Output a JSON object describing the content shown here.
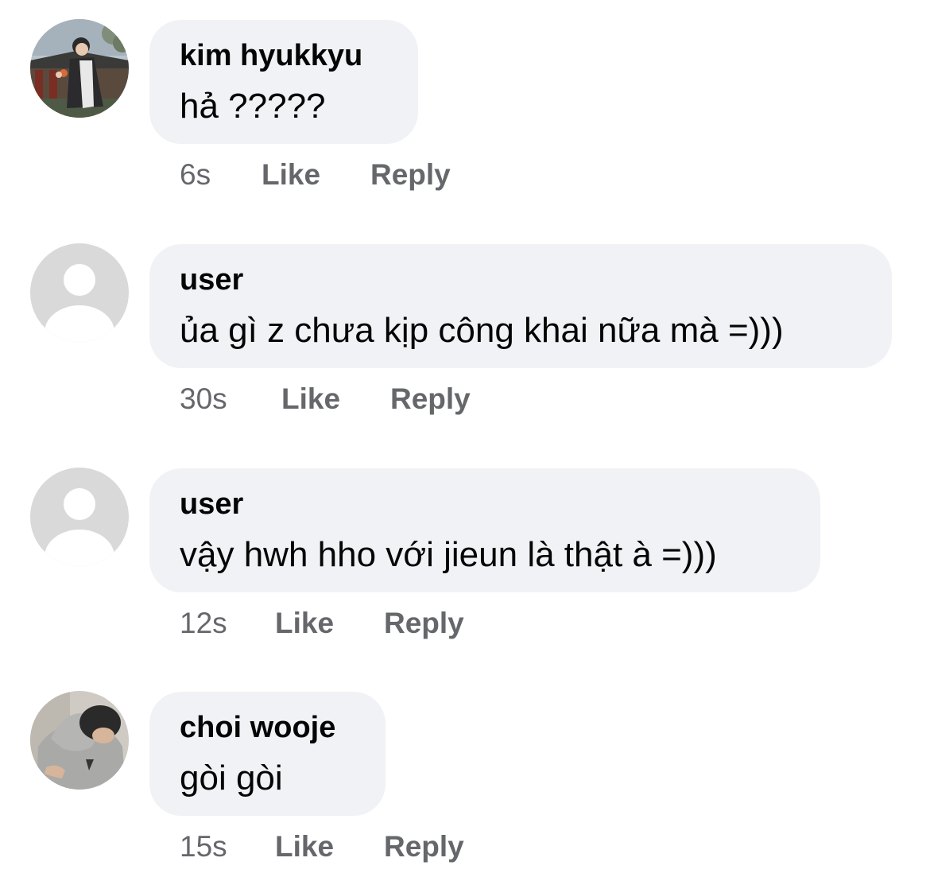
{
  "comments": [
    {
      "author": "kim hyukkyu",
      "text": "hả ?????",
      "time": "6s",
      "like_label": "Like",
      "reply_label": "Reply",
      "avatar": "user-photo-outdoor"
    },
    {
      "author": "user",
      "text": "ủa gì z chưa kịp công khai nữa mà =)))",
      "time": "30s",
      "like_label": "Like",
      "reply_label": "Reply",
      "avatar": "default-profile-icon"
    },
    {
      "author": "user",
      "text": "vậy hwh hho với jieun là thật à =)))",
      "time": "12s",
      "like_label": "Like",
      "reply_label": "Reply",
      "avatar": "default-profile-icon"
    },
    {
      "author": "choi wooje",
      "text": "gòi gòi",
      "time": "15s",
      "like_label": "Like",
      "reply_label": "Reply",
      "avatar": "user-photo-hoodie"
    }
  ],
  "colors": {
    "bubble_background": "#f0f2f5",
    "primary_text": "#050505",
    "secondary_text": "#65676b",
    "default_avatar_background": "#d9d9d9"
  }
}
